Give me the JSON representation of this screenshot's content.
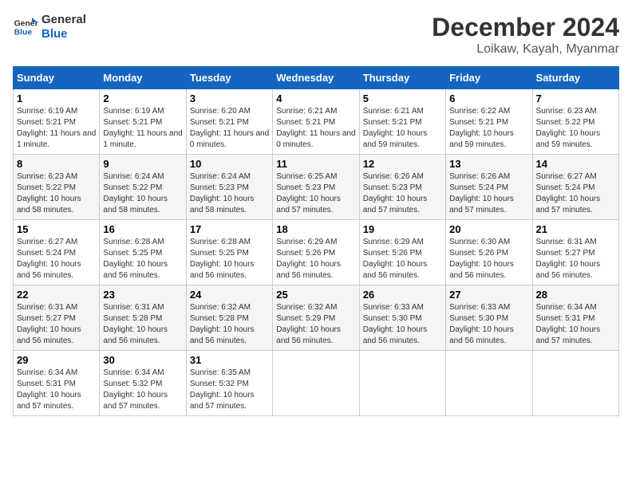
{
  "header": {
    "logo_text_general": "General",
    "logo_text_blue": "Blue",
    "month": "December 2024",
    "location": "Loikaw, Kayah, Myanmar"
  },
  "weekdays": [
    "Sunday",
    "Monday",
    "Tuesday",
    "Wednesday",
    "Thursday",
    "Friday",
    "Saturday"
  ],
  "weeks": [
    [
      {
        "day": "1",
        "sunrise": "6:19 AM",
        "sunset": "5:21 PM",
        "daylight": "11 hours and 1 minute."
      },
      {
        "day": "2",
        "sunrise": "6:19 AM",
        "sunset": "5:21 PM",
        "daylight": "11 hours and 1 minute."
      },
      {
        "day": "3",
        "sunrise": "6:20 AM",
        "sunset": "5:21 PM",
        "daylight": "11 hours and 0 minutes."
      },
      {
        "day": "4",
        "sunrise": "6:21 AM",
        "sunset": "5:21 PM",
        "daylight": "11 hours and 0 minutes."
      },
      {
        "day": "5",
        "sunrise": "6:21 AM",
        "sunset": "5:21 PM",
        "daylight": "10 hours and 59 minutes."
      },
      {
        "day": "6",
        "sunrise": "6:22 AM",
        "sunset": "5:21 PM",
        "daylight": "10 hours and 59 minutes."
      },
      {
        "day": "7",
        "sunrise": "6:23 AM",
        "sunset": "5:22 PM",
        "daylight": "10 hours and 59 minutes."
      }
    ],
    [
      {
        "day": "8",
        "sunrise": "6:23 AM",
        "sunset": "5:22 PM",
        "daylight": "10 hours and 58 minutes."
      },
      {
        "day": "9",
        "sunrise": "6:24 AM",
        "sunset": "5:22 PM",
        "daylight": "10 hours and 58 minutes."
      },
      {
        "day": "10",
        "sunrise": "6:24 AM",
        "sunset": "5:23 PM",
        "daylight": "10 hours and 58 minutes."
      },
      {
        "day": "11",
        "sunrise": "6:25 AM",
        "sunset": "5:23 PM",
        "daylight": "10 hours and 57 minutes."
      },
      {
        "day": "12",
        "sunrise": "6:26 AM",
        "sunset": "5:23 PM",
        "daylight": "10 hours and 57 minutes."
      },
      {
        "day": "13",
        "sunrise": "6:26 AM",
        "sunset": "5:24 PM",
        "daylight": "10 hours and 57 minutes."
      },
      {
        "day": "14",
        "sunrise": "6:27 AM",
        "sunset": "5:24 PM",
        "daylight": "10 hours and 57 minutes."
      }
    ],
    [
      {
        "day": "15",
        "sunrise": "6:27 AM",
        "sunset": "5:24 PM",
        "daylight": "10 hours and 56 minutes."
      },
      {
        "day": "16",
        "sunrise": "6:28 AM",
        "sunset": "5:25 PM",
        "daylight": "10 hours and 56 minutes."
      },
      {
        "day": "17",
        "sunrise": "6:28 AM",
        "sunset": "5:25 PM",
        "daylight": "10 hours and 56 minutes."
      },
      {
        "day": "18",
        "sunrise": "6:29 AM",
        "sunset": "5:26 PM",
        "daylight": "10 hours and 56 minutes."
      },
      {
        "day": "19",
        "sunrise": "6:29 AM",
        "sunset": "5:26 PM",
        "daylight": "10 hours and 56 minutes."
      },
      {
        "day": "20",
        "sunrise": "6:30 AM",
        "sunset": "5:26 PM",
        "daylight": "10 hours and 56 minutes."
      },
      {
        "day": "21",
        "sunrise": "6:31 AM",
        "sunset": "5:27 PM",
        "daylight": "10 hours and 56 minutes."
      }
    ],
    [
      {
        "day": "22",
        "sunrise": "6:31 AM",
        "sunset": "5:27 PM",
        "daylight": "10 hours and 56 minutes."
      },
      {
        "day": "23",
        "sunrise": "6:31 AM",
        "sunset": "5:28 PM",
        "daylight": "10 hours and 56 minutes."
      },
      {
        "day": "24",
        "sunrise": "6:32 AM",
        "sunset": "5:28 PM",
        "daylight": "10 hours and 56 minutes."
      },
      {
        "day": "25",
        "sunrise": "6:32 AM",
        "sunset": "5:29 PM",
        "daylight": "10 hours and 56 minutes."
      },
      {
        "day": "26",
        "sunrise": "6:33 AM",
        "sunset": "5:30 PM",
        "daylight": "10 hours and 56 minutes."
      },
      {
        "day": "27",
        "sunrise": "6:33 AM",
        "sunset": "5:30 PM",
        "daylight": "10 hours and 56 minutes."
      },
      {
        "day": "28",
        "sunrise": "6:34 AM",
        "sunset": "5:31 PM",
        "daylight": "10 hours and 57 minutes."
      }
    ],
    [
      {
        "day": "29",
        "sunrise": "6:34 AM",
        "sunset": "5:31 PM",
        "daylight": "10 hours and 57 minutes."
      },
      {
        "day": "30",
        "sunrise": "6:34 AM",
        "sunset": "5:32 PM",
        "daylight": "10 hours and 57 minutes."
      },
      {
        "day": "31",
        "sunrise": "6:35 AM",
        "sunset": "5:32 PM",
        "daylight": "10 hours and 57 minutes."
      },
      null,
      null,
      null,
      null
    ]
  ]
}
